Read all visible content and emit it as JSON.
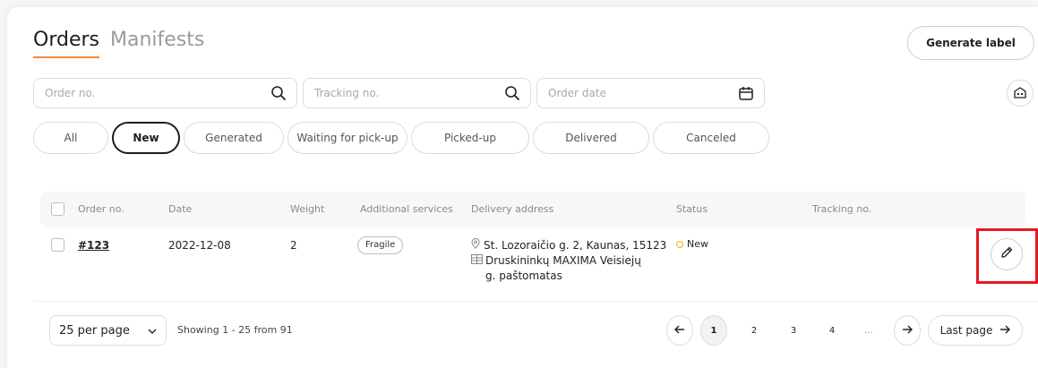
{
  "tabs": {
    "orders": "Orders",
    "manifests": "Manifests"
  },
  "header": {
    "generate_label": "Generate label"
  },
  "filters": {
    "order_no_placeholder": "Order no.",
    "tracking_no_placeholder": "Tracking no.",
    "order_date_placeholder": "Order date"
  },
  "status_chips": [
    {
      "label": "All"
    },
    {
      "label": "New"
    },
    {
      "label": "Generated"
    },
    {
      "label": "Waiting for pick-up"
    },
    {
      "label": "Picked-up"
    },
    {
      "label": "Delivered"
    },
    {
      "label": "Canceled"
    }
  ],
  "table": {
    "headers": {
      "order_no": "Order no.",
      "date": "Date",
      "weight": "Weight",
      "services": "Additional services",
      "address": "Delivery address",
      "status": "Status",
      "tracking": "Tracking no."
    },
    "rows": [
      {
        "order_no": "#123",
        "date": "2022-12-08",
        "weight": "2",
        "service": "Fragile",
        "address_line1": "St. Lozoraičio g. 2, Kaunas, 15123",
        "address_line2": "Druskininkų MAXIMA Veisiejų",
        "address_line3": "g. paštomatas",
        "status": "New"
      }
    ]
  },
  "pagination": {
    "per_page": "25 per page",
    "showing": "Showing 1 - 25 from 91",
    "pages": [
      "1",
      "2",
      "3",
      "4",
      "..."
    ],
    "last_page": "Last page"
  },
  "colors": {
    "accent": "#f08a3c",
    "status_new": "#f0b400",
    "highlight": "#e31b23"
  }
}
